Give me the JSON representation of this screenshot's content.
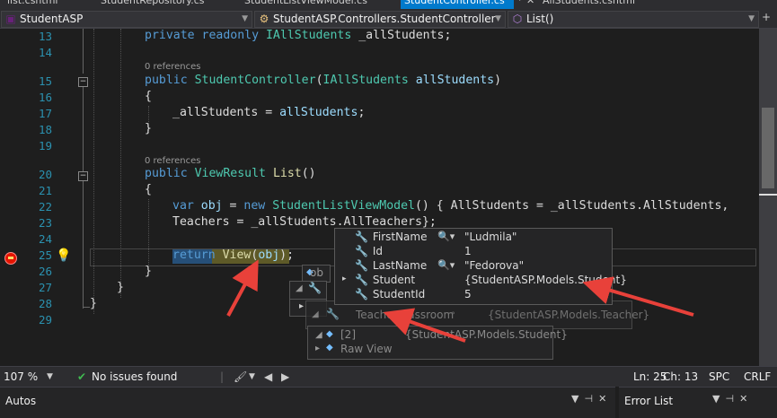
{
  "tabs": [
    {
      "label": "list.cshtml"
    },
    {
      "label": "StudentRepository.cs"
    },
    {
      "label": "StudentListViewModel.cs"
    },
    {
      "label": "StudentController.cs"
    },
    {
      "label": "AllStudents.cshtml"
    }
  ],
  "navbar": {
    "project": "StudentASP",
    "class": "StudentASP.Controllers.StudentController",
    "member": "List()"
  },
  "editor": {
    "line_numbers": [
      "13",
      "14",
      "15",
      "16",
      "17",
      "18",
      "19",
      "20",
      "21",
      "22",
      "23",
      "24",
      "25",
      "26",
      "27",
      "28",
      "29"
    ],
    "references_label": "0 references",
    "lines": {
      "l13": {
        "k": "private readonly ",
        "t": "IAllStudents",
        "r": " _allStudents;"
      },
      "l15": {
        "k": "public ",
        "m": "StudentController",
        "a": "(",
        "t": "IAllStudents",
        "b": " ",
        "p": "allStudents",
        "c": ")"
      },
      "l16": "{",
      "l17": {
        "a": "_allStudents = ",
        "p": "allStudents",
        "b": ";"
      },
      "l18": "}",
      "l20": {
        "k": "public ",
        "t": "ViewResult",
        "a": " ",
        "m": "List",
        "b": "()"
      },
      "l21": "{",
      "l22": {
        "k": "var ",
        "p": "obj",
        "a": " = ",
        "k2": "new ",
        "t": "StudentListViewModel",
        "b": "() { AllStudents = _allStudents.AllStudents,"
      },
      "l23": "Teachers = _allStudents.AllTeachers};",
      "l25": {
        "k": "return",
        "a": " ",
        "m": "View",
        "b": "(",
        "p": "obj",
        "c": ");"
      },
      "l26": "}",
      "l27": "}",
      "l28": "}"
    }
  },
  "datatip_main": {
    "rows": [
      {
        "name": "FirstName",
        "value": "\"Ludmila\"",
        "has_search": true
      },
      {
        "name": "Id",
        "value": "1",
        "has_search": false
      },
      {
        "name": "LastName",
        "value": "\"Fedorova\"",
        "has_search": true
      },
      {
        "name": "Student",
        "value": "{StudentASP.Models.Student}",
        "has_search": false
      },
      {
        "name": "StudentId",
        "value": "5",
        "has_search": false
      }
    ]
  },
  "datatip_back": {
    "obj_label": "ob",
    "teacher_classroom_name": "TeacherClassroom",
    "teacher_classroom_value": "{StudentASP.Models.Teacher}",
    "index_name": "[2]",
    "index_value": "{StudentASP.Models.Student}",
    "raw_view": "Raw View"
  },
  "status": {
    "zoom": "107 %",
    "issues": "No issues found",
    "line": "Ln: 25",
    "col": "Ch: 13",
    "spc": "SPC",
    "eol": "CRLF"
  },
  "panels": {
    "autos_title": "Autos",
    "errors_title": "Error List"
  },
  "colors": {
    "accent": "#007acc",
    "arrow": "#e8413a",
    "keyword": "#569cd6",
    "type": "#4ec9b0",
    "method": "#dcdcaa",
    "param": "#9cdcfe"
  }
}
